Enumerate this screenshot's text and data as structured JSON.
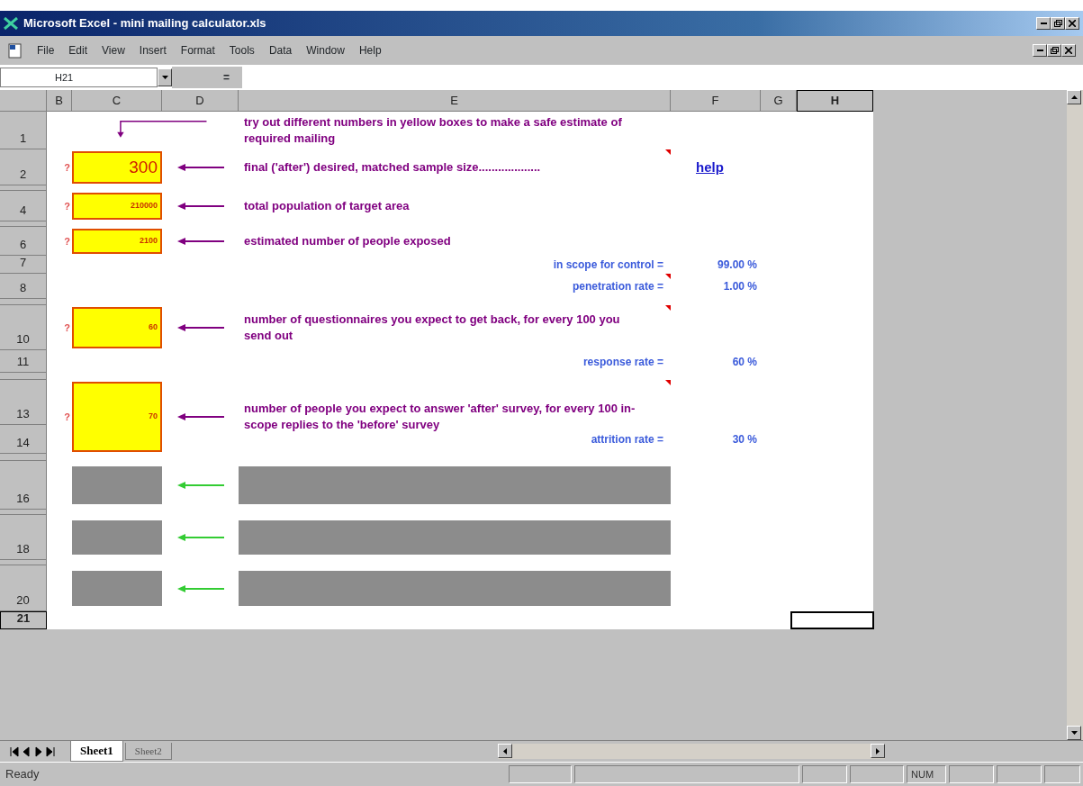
{
  "window": {
    "title": "Microsoft Excel - mini mailing calculator.xls"
  },
  "menu": [
    "File",
    "Edit",
    "View",
    "Insert",
    "Format",
    "Tools",
    "Data",
    "Window",
    "Help"
  ],
  "formula_bar": {
    "name_box": "H21",
    "equals": "="
  },
  "columns": [
    {
      "label": "B",
      "selected": false
    },
    {
      "label": "C",
      "selected": false
    },
    {
      "label": "D",
      "selected": false
    },
    {
      "label": "E",
      "selected": false
    },
    {
      "label": "F",
      "selected": false
    },
    {
      "label": "G",
      "selected": false
    },
    {
      "label": "H",
      "selected": true
    }
  ],
  "rows": [
    {
      "label": "1",
      "selected": false
    },
    {
      "label": "2",
      "selected": false
    },
    {
      "label": "4",
      "selected": false
    },
    {
      "label": "6",
      "selected": false
    },
    {
      "label": "7",
      "selected": false
    },
    {
      "label": "8",
      "selected": false
    },
    {
      "label": "10",
      "selected": false
    },
    {
      "label": "11",
      "selected": false
    },
    {
      "label": "13",
      "selected": false
    },
    {
      "label": "14",
      "selected": false
    },
    {
      "label": "16",
      "selected": false
    },
    {
      "label": "18",
      "selected": false
    },
    {
      "label": "20",
      "selected": false
    },
    {
      "label": "21",
      "selected": true
    }
  ],
  "intro": "try out different numbers in yellow boxes to make a safe estimate of required mailing",
  "inputs": [
    {
      "mark": "?",
      "value": "300",
      "note": "final ('after') desired, matched sample size...................",
      "comment": true
    },
    {
      "mark": "?",
      "value": "210000",
      "note": "total population of target area",
      "comment": false
    },
    {
      "mark": "?",
      "value": "2100",
      "note": "estimated number of people exposed",
      "comment": false
    },
    {
      "mark": "?",
      "value": "60",
      "note": "number of questionnaires you expect to get back, for every 100 you send out",
      "comment": true
    },
    {
      "mark": "?",
      "value": "70",
      "note": "number of people you expect to answer 'after' survey, for every 100 in-scope replies to the 'before' survey",
      "comment": true
    }
  ],
  "help_link": "help",
  "results": [
    {
      "label": "in scope for control =",
      "value": "99.00 %",
      "comment": false
    },
    {
      "label": "penetration rate =",
      "value": "1.00 %",
      "comment": true
    },
    {
      "label": "response rate =",
      "value": "60 %",
      "comment": false
    },
    {
      "label": "attrition rate =",
      "value": "30 %",
      "comment": false
    }
  ],
  "sheet_tabs": [
    {
      "label": "Sheet1",
      "selected": true
    },
    {
      "label": "Sheet2",
      "selected": false
    }
  ],
  "status_bar": {
    "text": "Ready",
    "indicator": "NUM"
  }
}
